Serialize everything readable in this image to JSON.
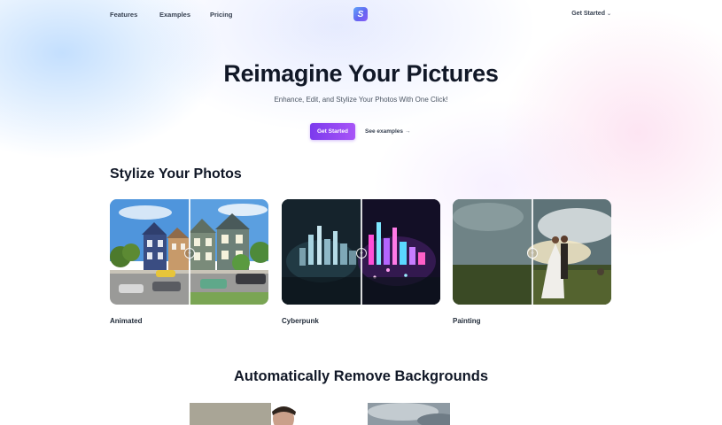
{
  "nav": {
    "links": [
      "Features",
      "Examples",
      "Pricing"
    ],
    "logo_letter": "S",
    "cta": "Get Started",
    "cta_icon": "chevron-down-icon"
  },
  "hero": {
    "title": "Reimagine Your Pictures",
    "subtitle": "Enhance, Edit, and Stylize Your Photos With One Click!",
    "primary_button": "Get Started",
    "secondary_link": "See examples",
    "secondary_icon": "arrow-right-icon"
  },
  "stylize": {
    "title": "Stylize Your Photos",
    "cards": [
      {
        "label": "Animated"
      },
      {
        "label": "Cyberpunk"
      },
      {
        "label": "Painting"
      }
    ],
    "handle_icon": "compare-arrows-icon"
  },
  "remove_bg": {
    "title": "Automatically Remove Backgrounds"
  },
  "colors": {
    "accent": "#7c3aed",
    "accent_light": "#a855f7",
    "text": "#111827"
  }
}
